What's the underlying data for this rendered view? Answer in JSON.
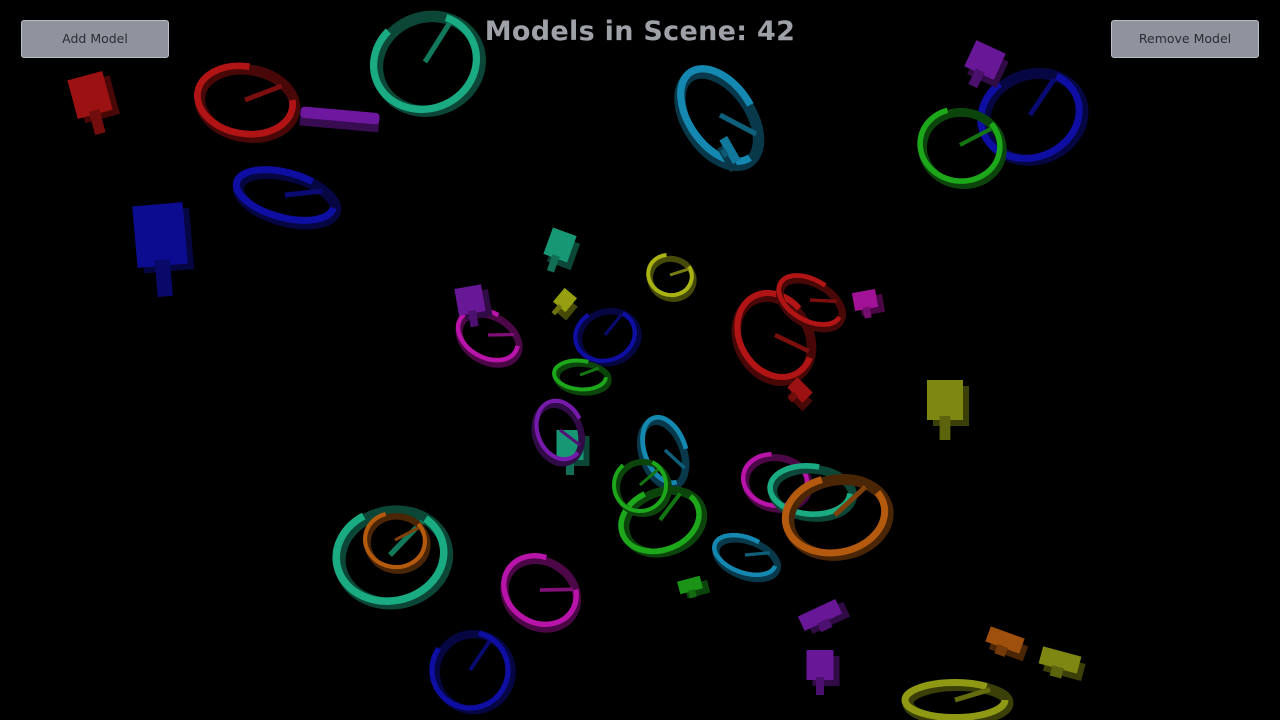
{
  "toolbar": {
    "add_label": "Add Model",
    "remove_label": "Remove Model"
  },
  "hud": {
    "counter_label": "Models in Scene:",
    "model_count": "42"
  },
  "palette": {
    "red": "#d01818",
    "purple": "#8a1ec8",
    "teal": "#1fc99a",
    "blue": "#1010c0",
    "cyan": "#18a0d0",
    "green": "#22c41e",
    "yellow": "#c8d218",
    "magenta": "#d818c8",
    "orange": "#d46a10",
    "olive": "#a8b418"
  },
  "scene": {
    "background": "#000000",
    "models": [
      {
        "shape": "ring",
        "color": "teal"
      },
      {
        "shape": "ring",
        "color": "red"
      },
      {
        "shape": "slab",
        "color": "red"
      },
      {
        "shape": "bar",
        "color": "purple"
      },
      {
        "shape": "slab",
        "color": "blue"
      },
      {
        "shape": "ring",
        "color": "blue"
      },
      {
        "shape": "ring",
        "color": "cyan"
      },
      {
        "shape": "ring",
        "color": "blue"
      },
      {
        "shape": "ring",
        "color": "green"
      },
      {
        "shape": "slab",
        "color": "purple"
      },
      {
        "shape": "slab",
        "color": "teal"
      },
      {
        "shape": "ring",
        "color": "magenta"
      },
      {
        "shape": "slab",
        "color": "purple"
      },
      {
        "shape": "ring",
        "color": "blue"
      },
      {
        "shape": "ring",
        "color": "green"
      },
      {
        "shape": "slab",
        "color": "yellow"
      },
      {
        "shape": "ring",
        "color": "red"
      },
      {
        "shape": "slab",
        "color": "magenta"
      },
      {
        "shape": "slab",
        "color": "olive"
      },
      {
        "shape": "ring",
        "color": "red"
      },
      {
        "shape": "slab",
        "color": "teal"
      },
      {
        "shape": "ring",
        "color": "cyan"
      },
      {
        "shape": "ring",
        "color": "green"
      },
      {
        "shape": "ring",
        "color": "magenta"
      },
      {
        "shape": "ring",
        "color": "teal"
      },
      {
        "shape": "ring",
        "color": "orange"
      },
      {
        "shape": "ring",
        "color": "cyan"
      },
      {
        "shape": "ring",
        "color": "teal"
      },
      {
        "shape": "ring",
        "color": "orange"
      },
      {
        "shape": "ring",
        "color": "magenta"
      },
      {
        "shape": "ring",
        "color": "blue"
      },
      {
        "shape": "slab",
        "color": "purple"
      },
      {
        "shape": "slab",
        "color": "purple"
      },
      {
        "shape": "slab",
        "color": "green"
      },
      {
        "shape": "slab",
        "color": "orange"
      },
      {
        "shape": "ring",
        "color": "olive"
      },
      {
        "shape": "ring",
        "color": "yellow"
      },
      {
        "shape": "slab",
        "color": "cyan"
      },
      {
        "shape": "ring",
        "color": "green"
      },
      {
        "shape": "slab",
        "color": "red"
      },
      {
        "shape": "ring",
        "color": "purple"
      },
      {
        "shape": "slab",
        "color": "olive"
      }
    ]
  }
}
